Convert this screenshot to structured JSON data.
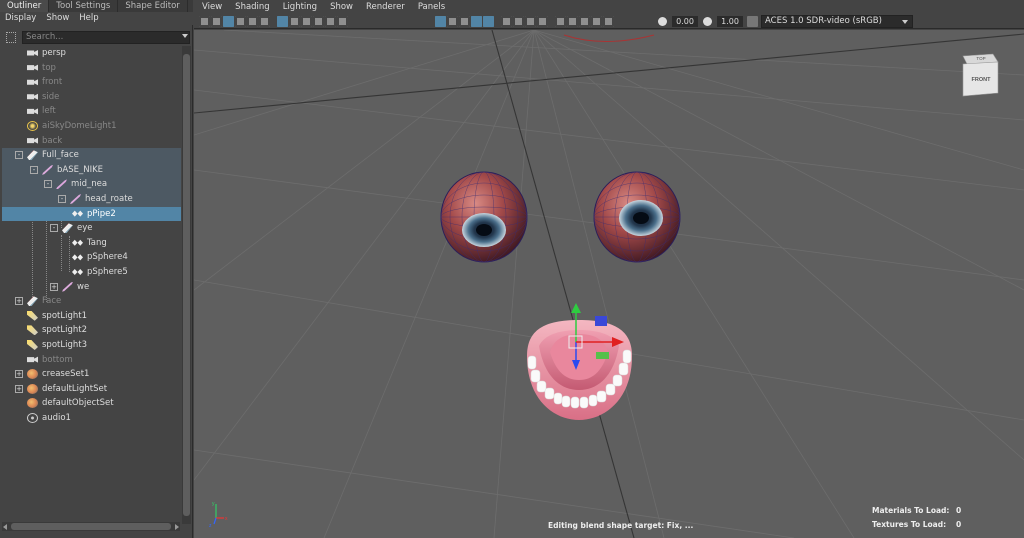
{
  "tabs": [
    "Outliner",
    "Tool Settings",
    "Shape Editor"
  ],
  "outliner_menu": [
    "Display",
    "Show",
    "Help"
  ],
  "search": {
    "placeholder": "Search..."
  },
  "tree_items": [
    {
      "label": "persp",
      "icon": "camera-icon"
    },
    {
      "label": "top",
      "icon": "camera-icon"
    },
    {
      "label": "front",
      "icon": "camera-icon"
    },
    {
      "label": "side",
      "icon": "camera-icon"
    },
    {
      "label": "left",
      "icon": "camera-icon"
    },
    {
      "label": "aiSkyDomeLight1",
      "icon": "skydome-light-icon"
    },
    {
      "label": "back",
      "icon": "camera-icon"
    },
    {
      "label": "Full_face",
      "icon": "transform-icon"
    },
    {
      "label": "bASE_NIKE",
      "icon": "joint-icon"
    },
    {
      "label": "mid_nea",
      "icon": "joint-icon"
    },
    {
      "label": "head_roate",
      "icon": "joint-icon"
    },
    {
      "label": "pPipe2",
      "icon": "mesh-icon"
    },
    {
      "label": "eye",
      "icon": "transform-icon"
    },
    {
      "label": "Tang",
      "icon": "mesh-icon"
    },
    {
      "label": "pSphere4",
      "icon": "mesh-icon"
    },
    {
      "label": "pSphere5",
      "icon": "mesh-icon"
    },
    {
      "label": "we",
      "icon": "joint-icon"
    },
    {
      "label": "Face",
      "icon": "transform-icon"
    },
    {
      "label": "spotLight1",
      "icon": "spotlight-icon"
    },
    {
      "label": "spotLight2",
      "icon": "spotlight-icon"
    },
    {
      "label": "spotLight3",
      "icon": "spotlight-icon"
    },
    {
      "label": "bottom",
      "icon": "camera-icon"
    },
    {
      "label": "creaseSet1",
      "icon": "set-icon"
    },
    {
      "label": "defaultLightSet",
      "icon": "set-icon"
    },
    {
      "label": "defaultObjectSet",
      "icon": "set-icon"
    },
    {
      "label": "audio1",
      "icon": "audio-icon"
    }
  ],
  "viewport_menu": [
    "View",
    "Shading",
    "Lighting",
    "Show",
    "Renderer",
    "Panels"
  ],
  "toolbar": {
    "exposure": "0.00",
    "gamma": "1.00",
    "color_space": "ACES 1.0 SDR-video (sRGB)"
  },
  "viewcube": {
    "top": "TOP",
    "front": "FRONT"
  },
  "hud": {
    "materials_label": "Materials To Load:",
    "materials_value": "0",
    "textures_label": "Textures To Load:",
    "textures_value": "0",
    "status": "Editing blend shape target: Fix, ..."
  },
  "axis_labels": {
    "x": "x",
    "y": "y",
    "z": "z"
  },
  "colors": {
    "selection": "#5285a6",
    "viewport_bg": "#5f5f5f",
    "panel_bg": "#444444"
  }
}
